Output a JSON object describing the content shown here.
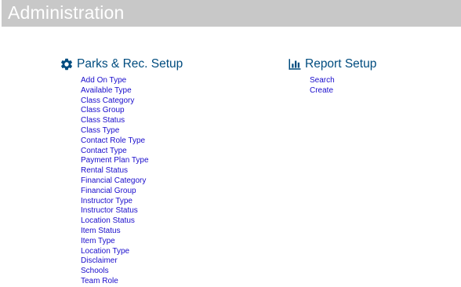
{
  "header": {
    "title": "Administration"
  },
  "parks_section": {
    "title": "Parks & Rec. Setup",
    "icon": "gear-icon",
    "items": [
      "Add On Type",
      "Available Type",
      "Class Category",
      "Class Group",
      "Class Status",
      "Class Type",
      "Contact Role Type",
      "Contact Type",
      "Payment Plan Type",
      "Rental Status",
      "Financial Category",
      "Financial Group",
      "Instructor Type",
      "Instructor Status",
      "Location Status",
      "Item Status",
      "Item Type",
      "Location Type",
      "Disclaimer",
      "Schools",
      "Team Role"
    ]
  },
  "report_section": {
    "title": "Report Setup",
    "icon": "bar-chart-icon",
    "items": [
      "Search",
      "Create"
    ]
  },
  "colors": {
    "header_bg": "#c8c8c8",
    "section_title": "#004c7f",
    "link": "#1a0dcc"
  }
}
